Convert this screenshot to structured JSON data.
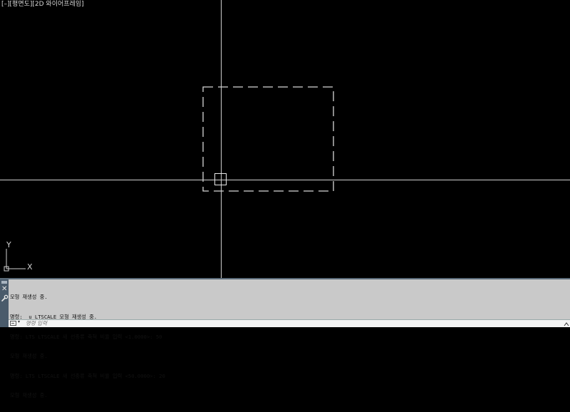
{
  "viewport": {
    "controls": {
      "minus": "[–]",
      "view": "[평면도]",
      "style": "[2D 와이어프레임]"
    },
    "ucs": {
      "x_label": "X",
      "y_label": "Y"
    },
    "colors": {
      "background": "#000000",
      "crosshair": "#cfcfcf",
      "geometry": "#d8d8d8"
    }
  },
  "command_line": {
    "history": [
      "모형 재생성 중.",
      "명령: _u LTSCALE 모형 재생성 중.",
      "명령: LTS LTSCALE 새 선종류 축척 비율 입력 <1.0000>: 50",
      "모형 재생성 중.",
      "명령: LTS LTSCALE 새 선종류 축척 비율 입력 <50.0000>: 20",
      "모형 재생성 중."
    ],
    "input_placeholder": "명령 입력",
    "icons": {
      "close": "close-icon",
      "customize": "wrench-icon",
      "command": "command-prompt-icon",
      "history_toggle": "chevron-up-icon"
    }
  }
}
